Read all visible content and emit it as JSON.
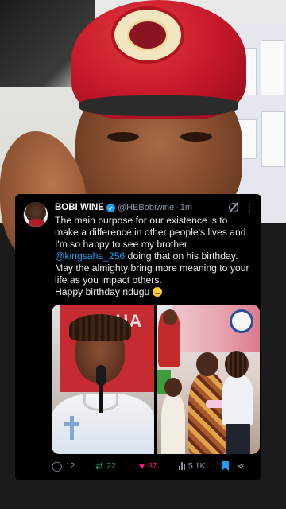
{
  "tweet": {
    "author_name": "BOBI WINE",
    "handle": "@HEBobiwine",
    "separator": "·",
    "time": "1m",
    "text_lines": {
      "line1": "The main purpose for our existence is to make a difference in other people's lives and I'm so happy to see my brother",
      "mention": "@kingsaha_256",
      "line2": " doing that on his birthday.",
      "line3": "May the almighty bring more meaning to your life as you impact others.",
      "line4": "Happy birthday ndugu"
    },
    "media_left_sign": "SAHA",
    "stats": {
      "replies": "12",
      "retweets": "22",
      "likes": "87",
      "views": "5.1K"
    },
    "icons": {
      "verified": "verified-badge-icon",
      "grok": "grok-icon",
      "more": "more-icon",
      "reply": "reply-icon",
      "retweet": "retweet-icon",
      "like": "heart-icon",
      "views": "views-icon",
      "bookmark": "bookmark-icon",
      "share": "share-icon"
    },
    "colors": {
      "background": "#000000",
      "text": "#e7e9ea",
      "muted": "#8b98a5",
      "link": "#1d9bf0",
      "retweet": "#00ba7c",
      "like": "#f91880"
    }
  }
}
